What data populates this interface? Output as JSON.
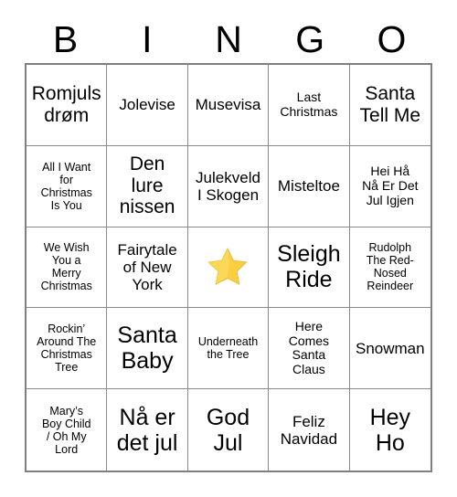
{
  "card": {
    "title": "BINGO",
    "header_letters": [
      "B",
      "I",
      "N",
      "G",
      "O"
    ],
    "grid_columns": 5,
    "grid_rows": 5,
    "colors": {
      "background": "#ffffff",
      "text": "#000000",
      "grid_line": "#8a8a8a",
      "outer_border": "#7f7f7f",
      "star_fill": "#f9cf41",
      "star_highlight": "#fde06a",
      "star_shadow": "#eebb33"
    },
    "free_space": {
      "row": 3,
      "column": 3,
      "icon": "star-icon",
      "glyph": "⭐",
      "label": ""
    },
    "cells": [
      [
        {
          "text": "Romjuls\ndrøm",
          "size": "lg"
        },
        {
          "text": "Jolevise",
          "size": "md"
        },
        {
          "text": "Musevisa",
          "size": "md"
        },
        {
          "text": "Last\nChristmas",
          "size": "sm"
        },
        {
          "text": "Santa\nTell Me",
          "size": "lg"
        }
      ],
      [
        {
          "text": "All I Want\nfor\nChristmas\nIs You",
          "size": "xs"
        },
        {
          "text": "Den\nlure\nnissen",
          "size": "lg"
        },
        {
          "text": "Julekveld\nI Skogen",
          "size": "md"
        },
        {
          "text": "Misteltoe",
          "size": "md"
        },
        {
          "text": "Hei Hå\nNå Er Det\nJul Igjen",
          "size": "sm"
        }
      ],
      [
        {
          "text": "We Wish\nYou a\nMerry\nChristmas",
          "size": "xs"
        },
        {
          "text": "Fairytale\nof New\nYork",
          "size": "md"
        },
        {
          "text": "",
          "size": "free"
        },
        {
          "text": "Sleigh\nRide",
          "size": "xl"
        },
        {
          "text": "Rudolph\nThe Red-\nNosed\nReindeer",
          "size": "xs"
        }
      ],
      [
        {
          "text": "Rockin’\nAround The\nChristmas\nTree",
          "size": "xs"
        },
        {
          "text": "Santa\nBaby",
          "size": "xl"
        },
        {
          "text": "Underneath\nthe Tree",
          "size": "xs"
        },
        {
          "text": "Here\nComes\nSanta\nClaus",
          "size": "sm"
        },
        {
          "text": "Snowman",
          "size": "md"
        }
      ],
      [
        {
          "text": "Mary’s\nBoy Child\n/ Oh My\nLord",
          "size": "xs"
        },
        {
          "text": "Nå er\ndet jul",
          "size": "xl"
        },
        {
          "text": "God\nJul",
          "size": "xl"
        },
        {
          "text": "Feliz\nNavidad",
          "size": "md"
        },
        {
          "text": "Hey\nHo",
          "size": "xl"
        }
      ]
    ]
  }
}
